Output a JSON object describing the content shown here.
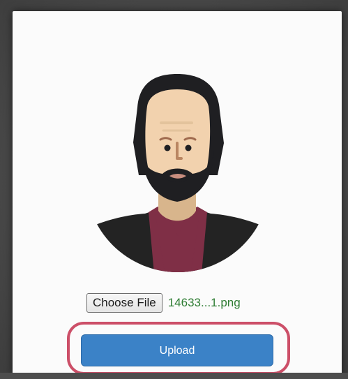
{
  "profile": {
    "avatar": {
      "icon_name": "man-with-beard-avatar-icon",
      "colors": {
        "hair": "#1f1f22",
        "skin": "#f2d2ae",
        "shirt": "#7f2f46",
        "jacket": "#232323"
      }
    },
    "file_upload": {
      "choose_label": "Choose File",
      "file_name": "14633...1.png",
      "file_name_color": "#2f7d34"
    },
    "upload": {
      "label": "Upload",
      "button_color": "#3b82c7",
      "highlight_color": "#c94660"
    }
  }
}
